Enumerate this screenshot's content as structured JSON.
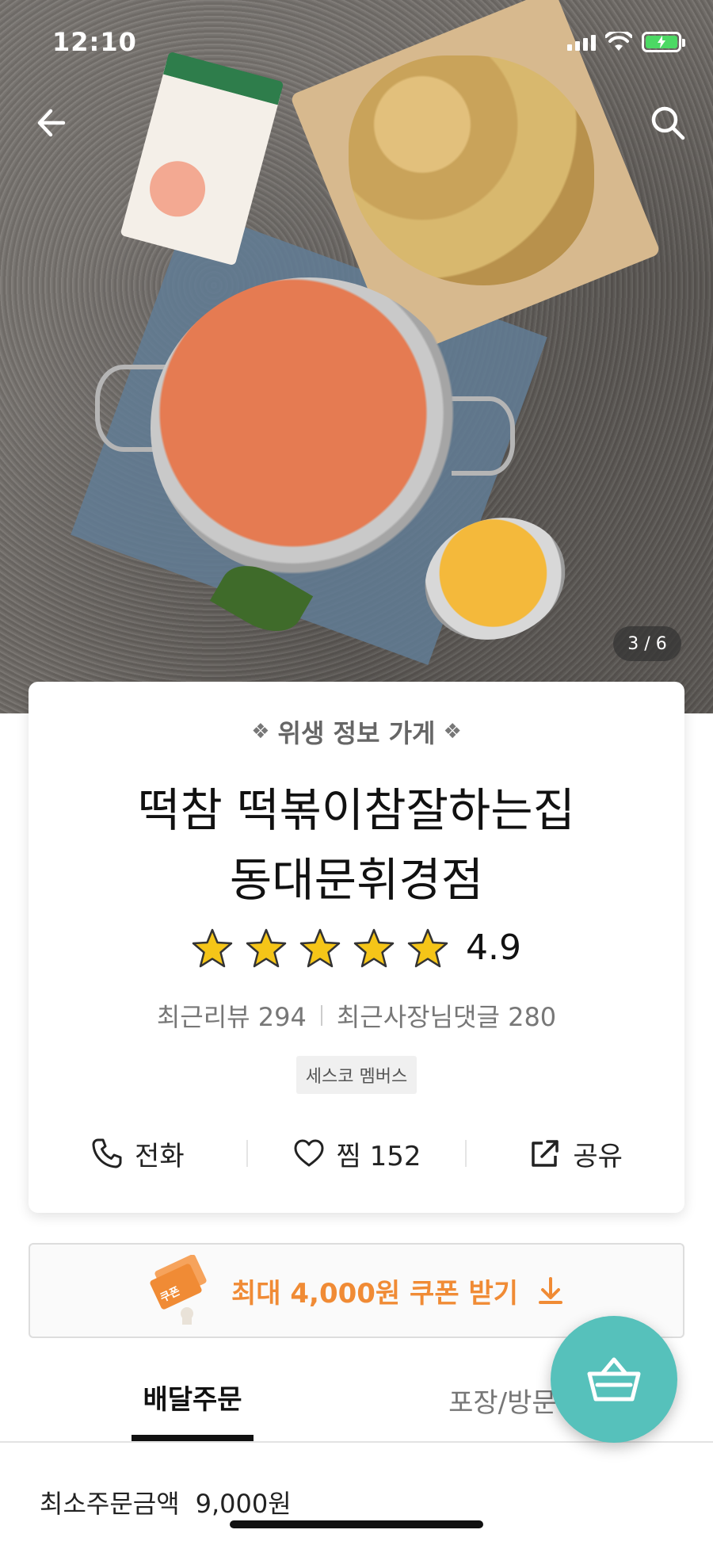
{
  "status_bar": {
    "time": "12:10"
  },
  "hero": {
    "page_counter": "3 / 6"
  },
  "store": {
    "hygiene_label": "위생 정보 가게",
    "name_line1": "떡참 떡볶이참잘하는집",
    "name_line2": "동대문휘경점",
    "rating": "4.9",
    "stars": 5,
    "recent_reviews_label": "최근리뷰 294",
    "recent_owner_replies_label": "최근사장님댓글 280",
    "badge": "세스코 멤버스"
  },
  "actions": {
    "call_label": "전화",
    "favorite_label": "찜 152",
    "share_label": "공유"
  },
  "coupon": {
    "icon_text": "쿠폰",
    "label": "최대 4,000원 쿠폰 받기"
  },
  "tabs": {
    "delivery": "배달주문",
    "pickup": "포장/방문주"
  },
  "order_info": {
    "min_order_label": "최소주문금액",
    "min_order_value": "9,000원"
  },
  "colors": {
    "accent_orange": "#f08b35",
    "cart_teal": "#56c1bb",
    "star_gold": "#f5c518"
  }
}
